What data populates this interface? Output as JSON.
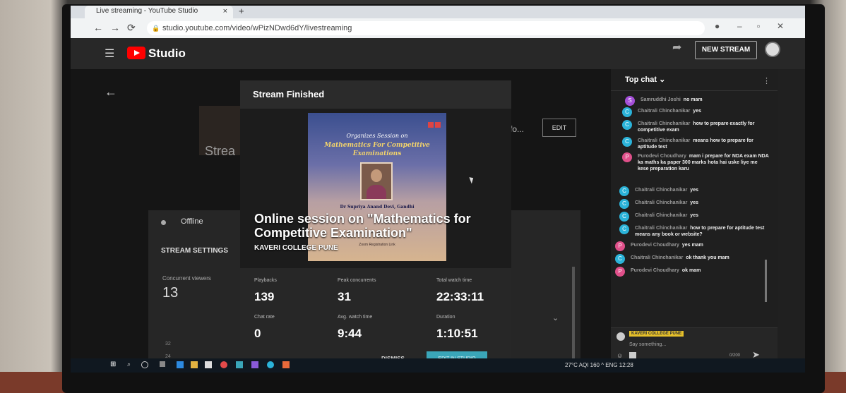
{
  "browser": {
    "tab_title": "Live streaming - YouTube Studio",
    "tab_close": "×",
    "new_tab": "+",
    "url": "studio.youtube.com/video/wPizNDwd6dY/livestreaming"
  },
  "studio": {
    "brand": "Studio",
    "new_stream_label": "NEW STREAM"
  },
  "background": {
    "stream_text": "Strea",
    "title_fragment": "fo...",
    "edit_label": "EDIT",
    "status": "Offline",
    "stream_settings": "STREAM SETTINGS",
    "concurrent_viewers_label": "Concurrent viewers",
    "concurrent_viewers_value": "13",
    "y_ticks": [
      "32",
      "24",
      "16"
    ],
    "dropdown_fragment": "s"
  },
  "modal": {
    "title": "Stream Finished",
    "thumbnail": {
      "org_text": "Organizes Session on",
      "headline": "Mathematics For Competitive Examinations",
      "speaker": "Dr Supriya Anand Devi, Gandhi",
      "reg": "Zoom Registration Link"
    },
    "session_title": "Online session on \"Mathematics for Competitive Examination\"",
    "college": "KAVERI COLLEGE PUNE",
    "stats": [
      {
        "label": "Playbacks",
        "value": "139"
      },
      {
        "label": "Peak concurrents",
        "value": "31"
      },
      {
        "label": "Total watch time",
        "value": "22:33:11"
      },
      {
        "label": "Chat rate",
        "value": "0"
      },
      {
        "label": "Avg. watch time",
        "value": "9:44"
      },
      {
        "label": "Duration",
        "value": "1:10:51"
      }
    ],
    "dismiss_label": "DISMISS",
    "edit_in_studio_label": "EDIT IN STUDIO"
  },
  "chat": {
    "header": "Top chat",
    "messages": [
      {
        "author": "Samruddhi Joshi",
        "text": "no mam",
        "initial": "S",
        "color": "#a44fd8"
      },
      {
        "author": "Chaitrali Chinchanikar",
        "text": "yes",
        "initial": "C",
        "color": "#2bb3d9"
      },
      {
        "author": "Chaitrali Chinchanikar",
        "text": "how to prepare exactly for competitive exam",
        "initial": "C",
        "color": "#2bb3d9"
      },
      {
        "author": "Chaitrali Chinchanikar",
        "text": "means how to prepare for aptitude test",
        "initial": "C",
        "color": "#2bb3d9"
      },
      {
        "author": "Purodevi Choudhary",
        "text": "mam i prepare for NDA exam NDA ka maths ka paper 300 marks hota hai uske liye me kese preparation karu",
        "initial": "P",
        "color": "#e0508a"
      },
      {
        "author": "Chaitrali Chinchanikar",
        "text": "yes",
        "initial": "C",
        "color": "#2bb3d9"
      },
      {
        "author": "Chaitrali Chinchanikar",
        "text": "yes",
        "initial": "C",
        "color": "#2bb3d9"
      },
      {
        "author": "Chaitrali Chinchanikar",
        "text": "yes",
        "initial": "C",
        "color": "#2bb3d9"
      },
      {
        "author": "Chaitrali Chinchanikar",
        "text": "how to prepare for aptitude test means any book or website?",
        "initial": "C",
        "color": "#2bb3d9"
      },
      {
        "author": "Purodevi Choudhary",
        "text": "yes mam",
        "initial": "P",
        "color": "#e0508a"
      },
      {
        "author": "Chaitrali Chinchanikar",
        "text": "ok thank you mam",
        "initial": "C",
        "color": "#2bb3d9"
      },
      {
        "author": "Purodevi Choudhary",
        "text": "ok mam",
        "initial": "P",
        "color": "#e0508a"
      }
    ],
    "input_name": "KAVERI COLLEGE PUNE",
    "input_placeholder": "Say something...",
    "counter": "0/200"
  },
  "taskbar": {
    "tray": "27°C  AQI 160  ^  ENG  12:28"
  },
  "colors": {
    "accent": "#3aa6b9",
    "yt_red": "#ff0000"
  }
}
